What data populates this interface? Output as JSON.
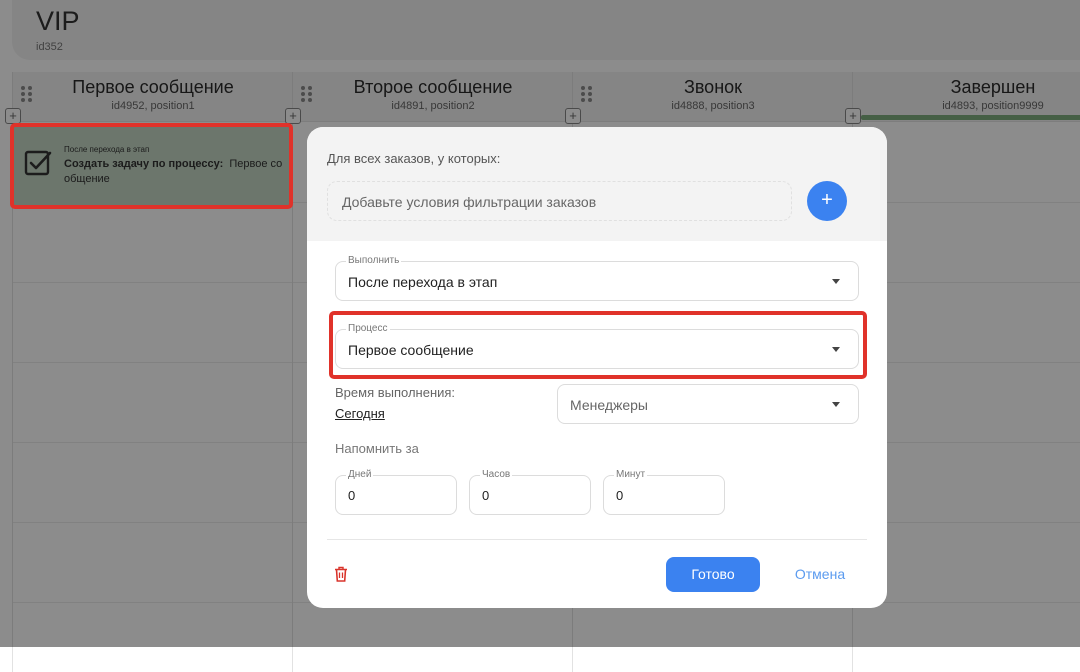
{
  "pipeline": {
    "title": "VIP",
    "id": "id352"
  },
  "columns": [
    {
      "title": "Первое сообщение",
      "subtitle": "id4952, position1"
    },
    {
      "title": "Второе сообщение",
      "subtitle": "id4891, position2"
    },
    {
      "title": "Звонок",
      "subtitle": "id4888, position3"
    },
    {
      "title": "Завершен",
      "subtitle": "id4893, position9999"
    }
  ],
  "add_column_symbol": "+",
  "automation_card": {
    "icon": "checkbox-checked-icon",
    "trigger": "После перехода в этап",
    "action_label": "Создать задачу по процессу:",
    "action_value": "Первое со общение"
  },
  "modal": {
    "filter": {
      "label": "Для всех заказов, у которых:",
      "placeholder": "Добавьте условия фильтрации заказов",
      "add_symbol": "+"
    },
    "execute": {
      "legend": "Выполнить",
      "value": "После перехода в этап"
    },
    "process": {
      "legend": "Процесс",
      "value": "Первое сообщение"
    },
    "execution_time": {
      "label": "Время выполнения:",
      "value": "Сегодня"
    },
    "managers": {
      "placeholder": "Менеджеры"
    },
    "remind": {
      "label": "Напомнить за",
      "fields": [
        {
          "legend": "Дней",
          "value": "0"
        },
        {
          "legend": "Часов",
          "value": "0"
        },
        {
          "legend": "Минут",
          "value": "0"
        }
      ]
    },
    "delete_icon": "trash-icon",
    "done_label": "Готово",
    "cancel_label": "Отмена"
  },
  "colors": {
    "accent": "#3b82f0",
    "highlight": "#e0322a",
    "card_bg": "#c5d8c5",
    "progress": "#7fae7e",
    "danger": "#d9342b"
  }
}
